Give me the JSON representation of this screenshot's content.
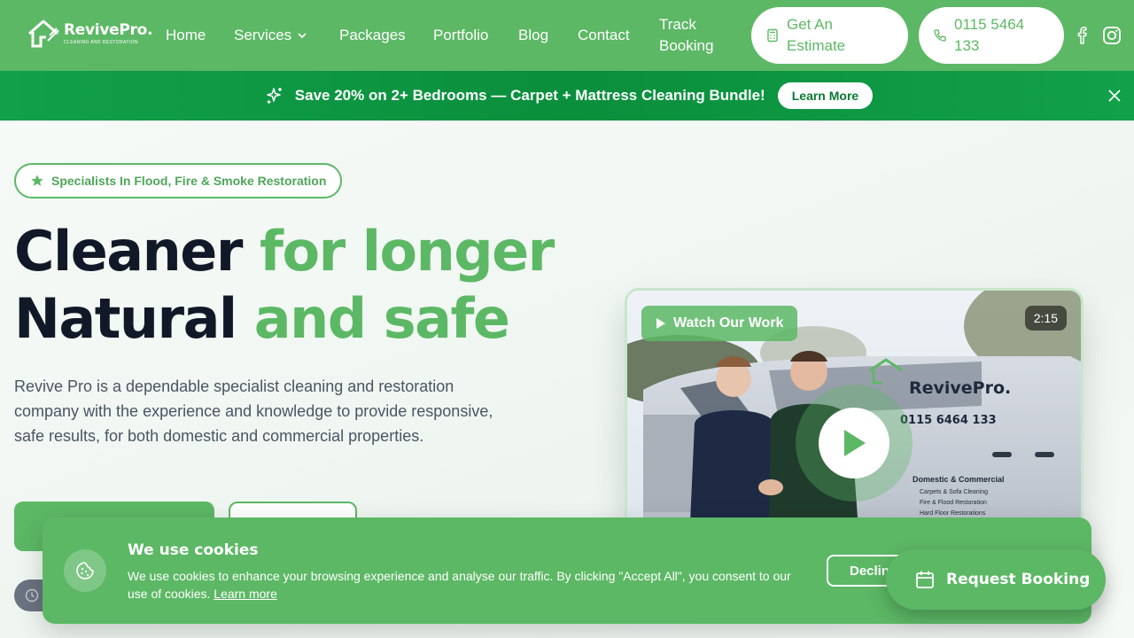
{
  "brand": {
    "name": "RevivePro.",
    "tagline": "CLEANING AND RESTORATION"
  },
  "nav": {
    "home": "Home",
    "services": "Services",
    "packages": "Packages",
    "portfolio": "Portfolio",
    "blog": "Blog",
    "contact": "Contact",
    "track_booking": "Track Booking"
  },
  "header_actions": {
    "estimate": "Get An Estimate",
    "phone": "0115 5464 133"
  },
  "promo": {
    "text": "Save 20% on 2+ Bedrooms — Carpet + Mattress Cleaning Bundle!",
    "button": "Learn More"
  },
  "hero": {
    "badge": "Specialists In Flood, Fire & Smoke Restoration",
    "line1_dark": "Cleaner",
    "line1_green": "for longer",
    "line2_dark": "Natural",
    "line2_green": "and safe",
    "lead": "Revive Pro is a dependable specialist cleaning and restoration company with the experience and knowledge to provide responsive, safe results, for both domestic and commercial properties."
  },
  "video": {
    "watch_label": "Watch Our Work",
    "duration": "2:15",
    "van_brand": "RevivePro.",
    "van_phone": "0115 6464 133",
    "van_heading": "Domestic & Commercial",
    "van_list": [
      "Carpets & Sofa Cleaning",
      "Fire & Flood Restoration",
      "Hard Floor Restorations"
    ]
  },
  "cookie": {
    "title": "We use cookies",
    "text": "We use cookies to enhance your browsing experience and analyse our traffic. By clicking \"Accept All\", you consent to our use of cookies.",
    "link": "Learn more",
    "decline": "Decline"
  },
  "floating": {
    "request_booking": "Request Booking"
  },
  "colors": {
    "brand_green": "#5cb865",
    "promo_green": "#0a8f3c",
    "heading_dark": "#111827"
  }
}
